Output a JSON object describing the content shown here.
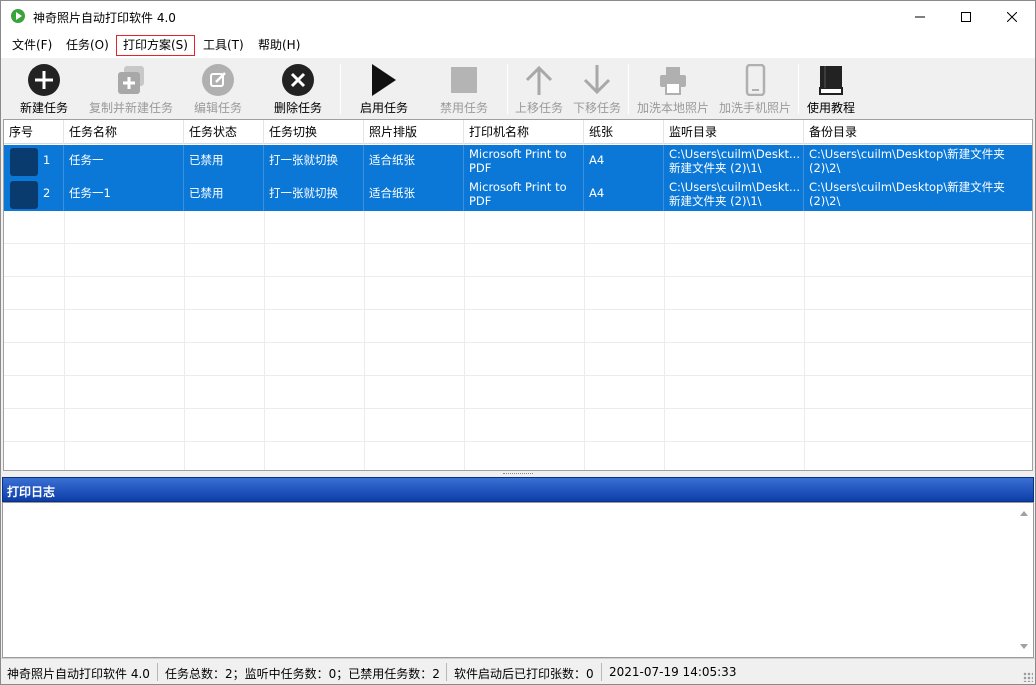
{
  "window": {
    "title": "神奇照片自动打印软件 4.0"
  },
  "menu": [
    "文件(F)",
    "任务(O)",
    "打印方案(S)",
    "工具(T)",
    "帮助(H)"
  ],
  "menu_highlighted": "打印方案(S)",
  "toolbar": {
    "new_task": "新建任务",
    "copy_new_task": "复制并新建任务",
    "edit_task": "编辑任务",
    "delete_task": "删除任务",
    "start_task": "启用任务",
    "disable_task": "禁用任务",
    "move_up": "上移任务",
    "move_down": "下移任务",
    "print_local": "加洗本地照片",
    "print_phone": "加洗手机照片",
    "tutorial": "使用教程"
  },
  "table": {
    "columns": [
      "序号",
      "任务名称",
      "任务状态",
      "任务切换",
      "照片排版",
      "打印机名称",
      "纸张",
      "监听目录",
      "备份目录"
    ],
    "rows": [
      {
        "index": "1",
        "name": "任务一",
        "status": "已禁用",
        "switch": "打一张就切换",
        "layout": "适合纸张",
        "printer_l1": "Microsoft Print to",
        "printer_l2": "PDF",
        "paper": "A4",
        "watch_l1": "C:\\Users\\cuilm\\Deskt...",
        "watch_l2": "新建文件夹 (2)\\1\\",
        "backup_l1": "C:\\Users\\cuilm\\Desktop\\新建文件夹",
        "backup_l2": "(2)\\2\\"
      },
      {
        "index": "2",
        "name": "任务一1",
        "status": "已禁用",
        "switch": "打一张就切换",
        "layout": "适合纸张",
        "printer_l1": "Microsoft Print to",
        "printer_l2": "PDF",
        "paper": "A4",
        "watch_l1": "C:\\Users\\cuilm\\Deskt...",
        "watch_l2": "新建文件夹 (2)\\1\\",
        "backup_l1": "C:\\Users\\cuilm\\Desktop\\新建文件夹",
        "backup_l2": "(2)\\2\\"
      }
    ]
  },
  "log": {
    "title": "打印日志"
  },
  "status": {
    "app": "神奇照片自动打印软件 4.0",
    "counts": "任务总数：2；监听中任务数：0；已禁用任务数：2",
    "printed": "软件启动后已打印张数：0",
    "datetime": "2021-07-19 14:05:33"
  },
  "colors": {
    "selection": "#0b78d7",
    "log_header": "#1a4fb8",
    "menu_highlight_border": "#e0262a"
  }
}
